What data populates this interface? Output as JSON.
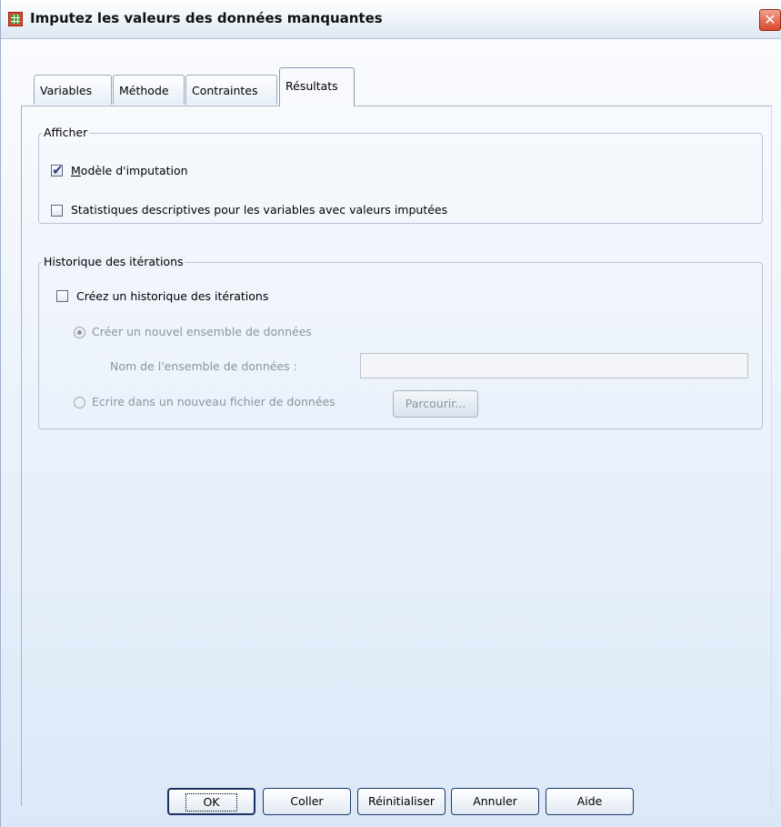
{
  "window": {
    "title": "Imputez les valeurs des données manquantes",
    "close_glyph": "✕"
  },
  "tabs": [
    {
      "label": "Variables"
    },
    {
      "label": "Méthode"
    },
    {
      "label": "Contraintes"
    },
    {
      "label": "Résultats",
      "active": true
    }
  ],
  "afficher": {
    "legend": "Afficher",
    "modele": {
      "label": "Modèle d'imputation",
      "checked": true
    },
    "stats": {
      "label": "Statistiques descriptives pour les variables avec valeurs imputées",
      "checked": false
    }
  },
  "historique": {
    "legend": "Historique des itérations",
    "creez": {
      "label": "Créez un historique des itérations",
      "checked": false
    },
    "radio_new": {
      "label": "Créer un nouvel ensemble de données",
      "selected": true
    },
    "dataset_name_label": "Nom de l'ensemble de données :",
    "dataset_name_value": "",
    "radio_file": {
      "label": "Ecrire dans un nouveau fichier de données",
      "selected": false
    },
    "browse_label": "Parcourir..."
  },
  "buttons": {
    "ok": "OK",
    "coller": "Coller",
    "reinitialiser": "Réinitialiser",
    "annuler": "Annuler",
    "aide": "Aide"
  },
  "colors": {
    "title_icon": "#d64a2b",
    "close": "#d6472a",
    "accent_border": "#1d3a67"
  }
}
